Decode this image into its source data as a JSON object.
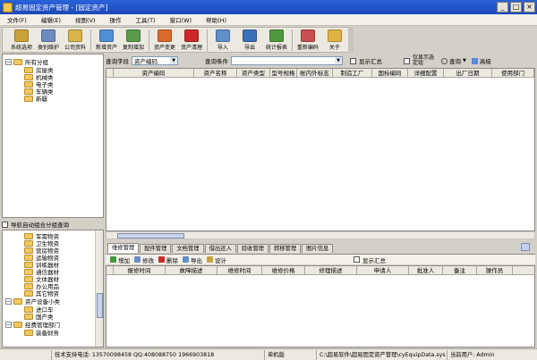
{
  "window": {
    "title": "超易固定资产管理 - [固定资产]",
    "min_glyph": "_",
    "max_glyph": "□",
    "close_glyph": "×"
  },
  "menu": [
    "文件(F)",
    "编辑(E)",
    "视图(V)",
    "操作",
    "工具(T)",
    "窗口(W)",
    "帮助(H)"
  ],
  "toolbar": [
    {
      "label": "系统选项",
      "color": "#c9a23a"
    },
    {
      "label": "类别维护",
      "color": "#6c8bbf"
    },
    {
      "label": "公司资料",
      "color": "#d9b44a"
    },
    {
      "label": "新增资产",
      "color": "#4f8fd6"
    },
    {
      "label": "复制增加",
      "color": "#5a9b4c"
    },
    {
      "label": "资产变更",
      "color": "#d96a2b"
    },
    {
      "label": "资产清理",
      "color": "#cc2a2a"
    },
    {
      "label": "导入",
      "color": "#5f8ec9"
    },
    {
      "label": "导出",
      "color": "#3c70b8"
    },
    {
      "label": "统计报表",
      "color": "#4f9a3f"
    },
    {
      "label": "重新编码",
      "color": "#c85050"
    },
    {
      "label": "关于",
      "color": "#e0b340"
    }
  ],
  "tree": {
    "root": "所有分组",
    "items": [
      "房屋类",
      "机械类",
      "电子类",
      "车辆类",
      "新疆"
    ]
  },
  "auto_group": {
    "label": "导航自动组合分组查询"
  },
  "tree2": {
    "items": [
      {
        "label": "军需物资",
        "level": 1
      },
      {
        "label": "卫生物资",
        "level": 1
      },
      {
        "label": "营房物资",
        "level": 1
      },
      {
        "label": "运输物资",
        "level": 1
      },
      {
        "label": "训练器材",
        "level": 1
      },
      {
        "label": "通信器材",
        "level": 1
      },
      {
        "label": "文体器材",
        "level": 1
      },
      {
        "label": "办公用品",
        "level": 1
      },
      {
        "label": "其它物资",
        "level": 1
      },
      {
        "label": "资产设备小类",
        "level": 0
      },
      {
        "label": "进口车",
        "level": 1
      },
      {
        "label": "国产类",
        "level": 1
      },
      {
        "label": "经费管理部门",
        "level": 0
      },
      {
        "label": "装备财务",
        "level": 1
      }
    ]
  },
  "query": {
    "field_label": "查询字段",
    "field_value": "资产编码",
    "cond_label": "查询条件",
    "cond_value": "",
    "summary_label": "显示汇总",
    "only_selected_label": "仅显示选定组",
    "query_btn": "查询",
    "advanced_btn": "高级"
  },
  "grid_columns": [
    "资产编码",
    "资产名称",
    "资产类型",
    "型号规格",
    "帐内外标志",
    "制造工厂",
    "国标编码",
    "详细配置",
    "出厂日期",
    "使用部门"
  ],
  "tabs": [
    "维修管理",
    "配件管理",
    "文档管理",
    "借出还入",
    "验收管理",
    "转移管理",
    "图片信息"
  ],
  "subtool": {
    "add": "增加",
    "edit": "修改",
    "delete": "删除",
    "export": "导出",
    "design": "设计",
    "summary": "显示汇总"
  },
  "grid2_columns": [
    "报修时间",
    "故障描述",
    "维修时间",
    "维修价格",
    "修理描述",
    "申请人",
    "批准人",
    "备注",
    "操作员"
  ],
  "status": {
    "support": "技术支持电话: 13570098458 QQ:408088750 1966903818",
    "mode": "单机版",
    "path": "C:\\超易软件\\超易固定资产管理\\cyEquipData.sys",
    "user": "当前用户: Admin"
  }
}
